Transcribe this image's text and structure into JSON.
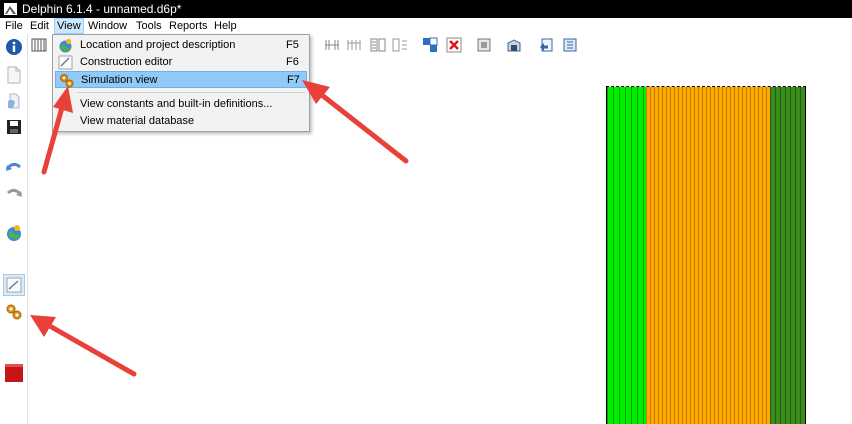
{
  "window": {
    "title": "Delphin 6.1.4 - unnamed.d6p*",
    "icon": "delphin-app-icon"
  },
  "menubar": {
    "items": [
      {
        "label": "File"
      },
      {
        "label": "Edit"
      },
      {
        "label": "View",
        "active": true
      },
      {
        "label": "Window"
      },
      {
        "label": "Tools"
      },
      {
        "label": "Reports"
      },
      {
        "label": "Help"
      }
    ]
  },
  "view_menu": {
    "items": [
      {
        "label": "Location and project description",
        "shortcut": "F5",
        "icon": "globe-pin-icon"
      },
      {
        "label": "Construction editor",
        "shortcut": "F6",
        "icon": "construction-editor-icon"
      },
      {
        "label": "Simulation view",
        "shortcut": "F7",
        "icon": "gears-icon",
        "highlighted": true
      },
      {
        "label": "View constants and built-in definitions...",
        "shortcut": ""
      },
      {
        "label": "View material database",
        "shortcut": ""
      }
    ]
  },
  "left_toolbar": {
    "buttons": [
      "info-icon",
      "new-file-icon",
      "open-file-icon",
      "save-icon",
      "undo-icon",
      "redo-icon",
      "location-icon",
      "construction-editor-icon",
      "simulation-gears-icon",
      "stop-icon"
    ],
    "pressed": "construction-editor-icon"
  },
  "top_toolbar": {
    "buttons": [
      "grid-lines-icon",
      "grid-refine-icon",
      "grid-coarse-icon",
      "split-icon",
      "merge-icon",
      "assign-icon",
      "delete-assignment-icon",
      "check-icon",
      "output-icon",
      "import-icon",
      "export-icon"
    ]
  },
  "construction": {
    "layers": [
      {
        "color": "#00ee00"
      },
      {
        "color": "#ffaa00"
      },
      {
        "color": "#3c8c1c"
      }
    ]
  },
  "annotations": {
    "arrow_color": "#e8413a"
  }
}
